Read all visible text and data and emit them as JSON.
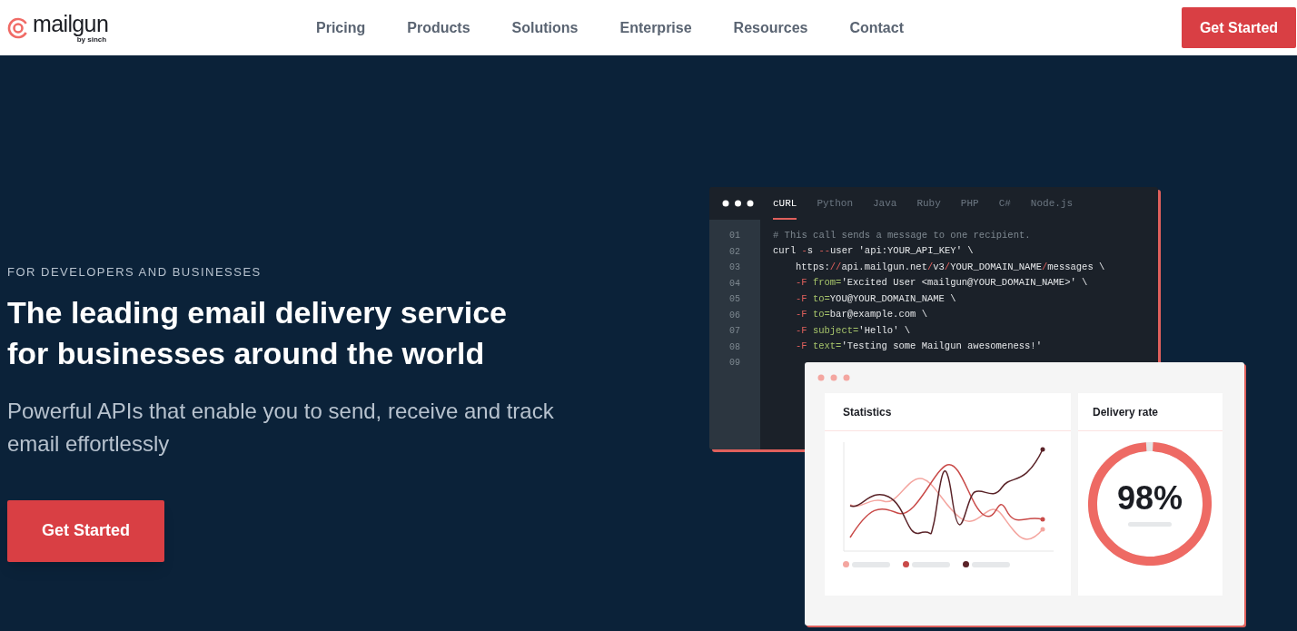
{
  "header": {
    "logo": {
      "name": "mailgun",
      "byline": "by sinch"
    },
    "nav": [
      "Pricing",
      "Products",
      "Solutions",
      "Enterprise",
      "Resources",
      "Contact"
    ],
    "cta": "Get Started"
  },
  "hero": {
    "eyebrow": "FOR DEVELOPERS AND BUSINESSES",
    "title": "The leading email delivery service for businesses around the world",
    "subtitle": "Powerful APIs that enable you to send, receive and track email effortlessly",
    "cta": "Get Started"
  },
  "code_window": {
    "tabs": [
      {
        "label": "cURL",
        "selected": true
      },
      {
        "label": "Python",
        "selected": false
      },
      {
        "label": "Java",
        "selected": false
      },
      {
        "label": "Ruby",
        "selected": false
      },
      {
        "label": "PHP",
        "selected": false
      },
      {
        "label": "C#",
        "selected": false
      },
      {
        "label": "Node.js",
        "selected": false
      }
    ],
    "lines": [
      {
        "number": "01",
        "indent": false,
        "segments": [
          {
            "kind": "comment",
            "text": "# This call sends a message to one recipient."
          }
        ]
      },
      {
        "number": "02",
        "indent": false,
        "segments": [
          {
            "kind": "plain",
            "text": "curl "
          },
          {
            "kind": "accent",
            "text": "-"
          },
          {
            "kind": "plain",
            "text": "s "
          },
          {
            "kind": "accent",
            "text": "--"
          },
          {
            "kind": "plain",
            "text": "user 'api:YOUR_API_KEY' \\"
          }
        ]
      },
      {
        "number": "03",
        "indent": true,
        "segments": [
          {
            "kind": "plain",
            "text": "https:"
          },
          {
            "kind": "accent",
            "text": "//"
          },
          {
            "kind": "plain",
            "text": "api.mailgun.net"
          },
          {
            "kind": "accent",
            "text": "/"
          },
          {
            "kind": "plain",
            "text": "v3"
          },
          {
            "kind": "accent",
            "text": "/"
          },
          {
            "kind": "plain",
            "text": "YOUR_DOMAIN_NAME"
          },
          {
            "kind": "accent",
            "text": "/"
          },
          {
            "kind": "plain",
            "text": "messages \\"
          }
        ]
      },
      {
        "number": "04",
        "indent": true,
        "segments": [
          {
            "kind": "accent",
            "text": "-F "
          },
          {
            "kind": "key",
            "text": "from="
          },
          {
            "kind": "plain",
            "text": "'Excited User <mailgun@YOUR_DOMAIN_NAME>' \\"
          }
        ]
      },
      {
        "number": "05",
        "indent": true,
        "segments": [
          {
            "kind": "accent",
            "text": "-F "
          },
          {
            "kind": "key",
            "text": "to="
          },
          {
            "kind": "plain",
            "text": "YOU@YOUR_DOMAIN_NAME \\"
          }
        ]
      },
      {
        "number": "06",
        "indent": true,
        "segments": [
          {
            "kind": "accent",
            "text": "-F "
          },
          {
            "kind": "key",
            "text": "to="
          },
          {
            "kind": "plain",
            "text": "bar@example.com \\"
          }
        ]
      },
      {
        "number": "07",
        "indent": true,
        "segments": [
          {
            "kind": "accent",
            "text": "-F "
          },
          {
            "kind": "key",
            "text": "subject="
          },
          {
            "kind": "plain",
            "text": "'Hello' \\"
          }
        ]
      },
      {
        "number": "08",
        "indent": true,
        "segments": [
          {
            "kind": "accent",
            "text": "-F "
          },
          {
            "kind": "key",
            "text": "text="
          },
          {
            "kind": "plain",
            "text": "'Testing some Mailgun awesomeness!'"
          }
        ]
      },
      {
        "number": "09",
        "indent": false
      }
    ]
  },
  "dashboard": {
    "statistics": {
      "title": "Statistics",
      "legend": [
        {
          "color": "#f4a6a0"
        },
        {
          "color": "#c94a48"
        },
        {
          "color": "#5a2328"
        }
      ]
    },
    "delivery_rate": {
      "title": "Delivery rate",
      "value": "98%",
      "level": 0.98
    }
  }
}
